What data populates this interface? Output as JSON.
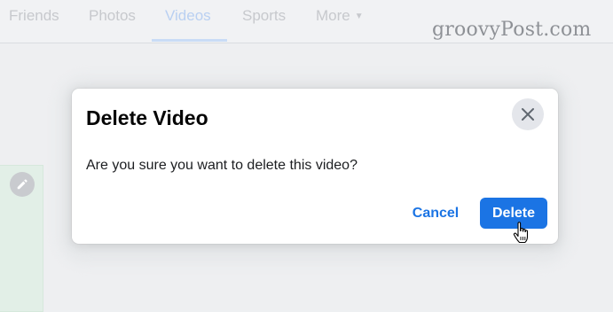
{
  "tabs": [
    {
      "label": "Friends",
      "active": false
    },
    {
      "label": "Photos",
      "active": false
    },
    {
      "label": "Videos",
      "active": true
    },
    {
      "label": "Sports",
      "active": false
    },
    {
      "label": "More",
      "active": false,
      "icon": "chevron-down-icon"
    }
  ],
  "watermark": "groovyPost.com",
  "dialog": {
    "title": "Delete Video",
    "message": "Are you sure you want to delete this video?",
    "close_icon": "close-icon",
    "cancel_label": "Cancel",
    "delete_label": "Delete"
  },
  "icons": {
    "edit": "pencil-icon",
    "cursor": "hand-pointer-icon"
  },
  "colors": {
    "primary": "#1b74e4",
    "dialog_bg": "#ffffff",
    "close_bg": "#e4e6eb",
    "title": "#050505",
    "page_bg": "#eeeff1"
  }
}
